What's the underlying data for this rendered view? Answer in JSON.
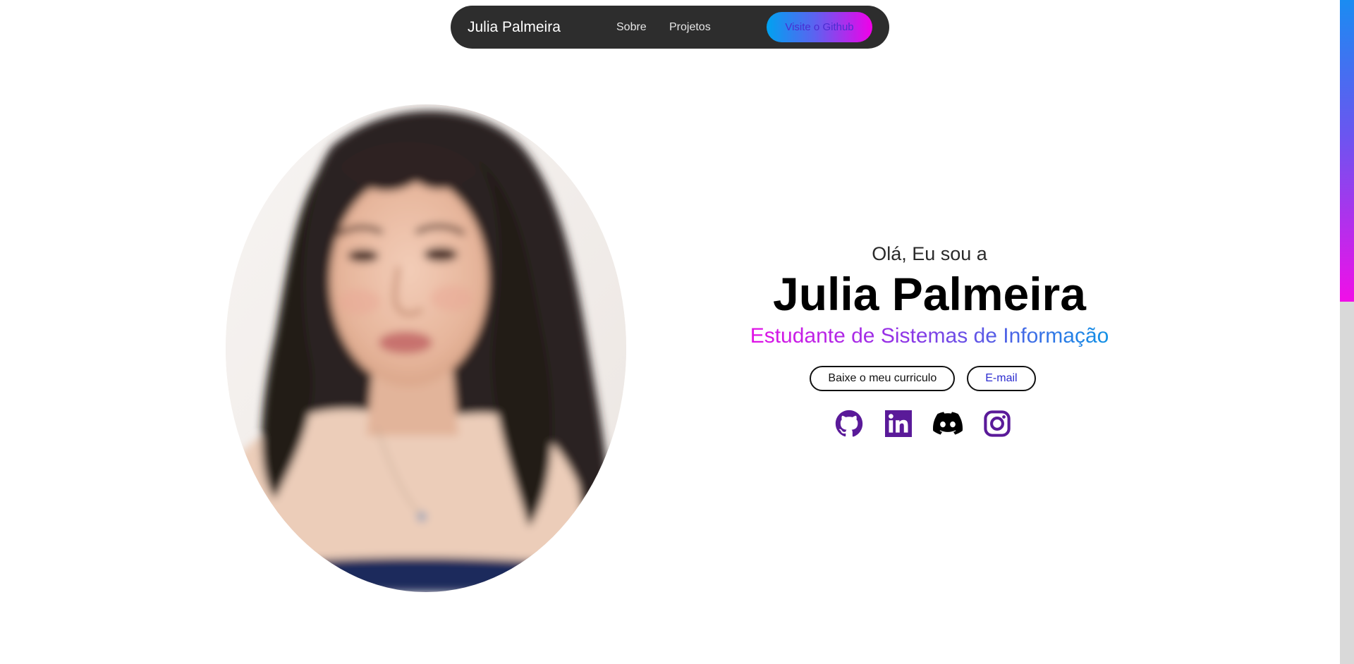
{
  "navbar": {
    "brand": "Julia Palmeira",
    "links": [
      {
        "label": "Sobre"
      },
      {
        "label": "Projetos"
      }
    ],
    "github_button": "Visite o Github"
  },
  "hero": {
    "greeting": "Olá, Eu sou a",
    "name": "Julia Palmeira",
    "subtitle": "Estudante de Sistemas de Informação",
    "buttons": {
      "resume": "Baixe o meu curriculo",
      "email": "E-mail"
    },
    "socials": [
      {
        "icon": "github-icon",
        "color": "#5a1a99"
      },
      {
        "icon": "linkedin-icon",
        "color": "#5a1a99"
      },
      {
        "icon": "discord-icon",
        "color": "#000000"
      },
      {
        "icon": "instagram-icon",
        "color": "#5a1a99"
      }
    ]
  },
  "colors": {
    "navbar_bg": "#2d2d2d",
    "gradient_start": "#00a2f0",
    "gradient_end": "#f100e8",
    "icon_purple": "#5a1a99"
  }
}
